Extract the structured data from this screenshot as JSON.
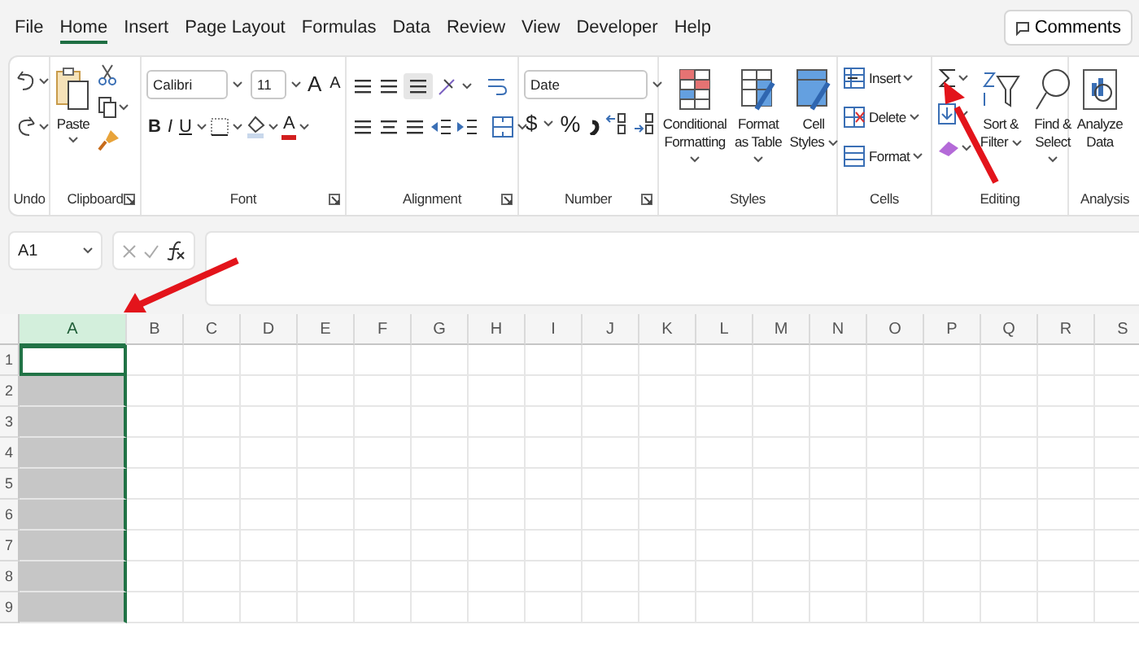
{
  "menu_tabs": [
    {
      "label": "File",
      "selected": false
    },
    {
      "label": "Home",
      "selected": true
    },
    {
      "label": "Insert",
      "selected": false
    },
    {
      "label": "Page Layout",
      "selected": false
    },
    {
      "label": "Formulas",
      "selected": false
    },
    {
      "label": "Data",
      "selected": false
    },
    {
      "label": "Review",
      "selected": false
    },
    {
      "label": "View",
      "selected": false
    },
    {
      "label": "Developer",
      "selected": false
    },
    {
      "label": "Help",
      "selected": false
    }
  ],
  "comments_button": "Comments",
  "ribbon_groups": [
    {
      "kind": "undo",
      "label": "Undo",
      "launcher": false
    },
    {
      "kind": "clipboard",
      "label": "Clipboard",
      "launcher": true,
      "paste": "Paste"
    },
    {
      "kind": "font",
      "label": "Font",
      "launcher": true,
      "font_name": "Calibri",
      "font_size": "11",
      "grow": "A",
      "shrink": "A",
      "styles": [
        "B",
        "I",
        "U"
      ],
      "font_color": "A"
    },
    {
      "kind": "alignment",
      "label": "Alignment",
      "launcher": true
    },
    {
      "kind": "number",
      "label": "Number",
      "launcher": true,
      "format": "Date",
      "currency": "$",
      "percent": "%"
    },
    {
      "kind": "styles",
      "label": "Styles",
      "launcher": false,
      "buttons": [
        "Conditional Formatting",
        "Format as Table",
        "Cell Styles"
      ]
    },
    {
      "kind": "cells",
      "label": "Cells",
      "launcher": false,
      "buttons": [
        "Insert",
        "Delete",
        "Format"
      ]
    },
    {
      "kind": "editing",
      "label": "Editing",
      "launcher": false,
      "buttons": [
        "Sort & Filter",
        "Find & Select"
      ]
    },
    {
      "kind": "analysis",
      "label": "Analysis",
      "launcher": false,
      "buttons": [
        "Analyze Data"
      ]
    }
  ],
  "formula_bar": {
    "name_box": "A1"
  },
  "sheet": {
    "columns": [
      {
        "label": "A",
        "selected": true
      },
      {
        "label": "B",
        "selected": false
      },
      {
        "label": "C",
        "selected": false
      },
      {
        "label": "D",
        "selected": false
      },
      {
        "label": "E",
        "selected": false
      },
      {
        "label": "F",
        "selected": false
      },
      {
        "label": "G",
        "selected": false
      },
      {
        "label": "H",
        "selected": false
      },
      {
        "label": "I",
        "selected": false
      },
      {
        "label": "J",
        "selected": false
      },
      {
        "label": "K",
        "selected": false
      },
      {
        "label": "L",
        "selected": false
      },
      {
        "label": "M",
        "selected": false
      },
      {
        "label": "N",
        "selected": false
      },
      {
        "label": "O",
        "selected": false
      },
      {
        "label": "P",
        "selected": false
      },
      {
        "label": "Q",
        "selected": false
      },
      {
        "label": "R",
        "selected": false
      },
      {
        "label": "S",
        "selected": false
      }
    ],
    "rows": [
      "1",
      "2",
      "3",
      "4",
      "5",
      "6",
      "7",
      "8",
      "9"
    ]
  }
}
